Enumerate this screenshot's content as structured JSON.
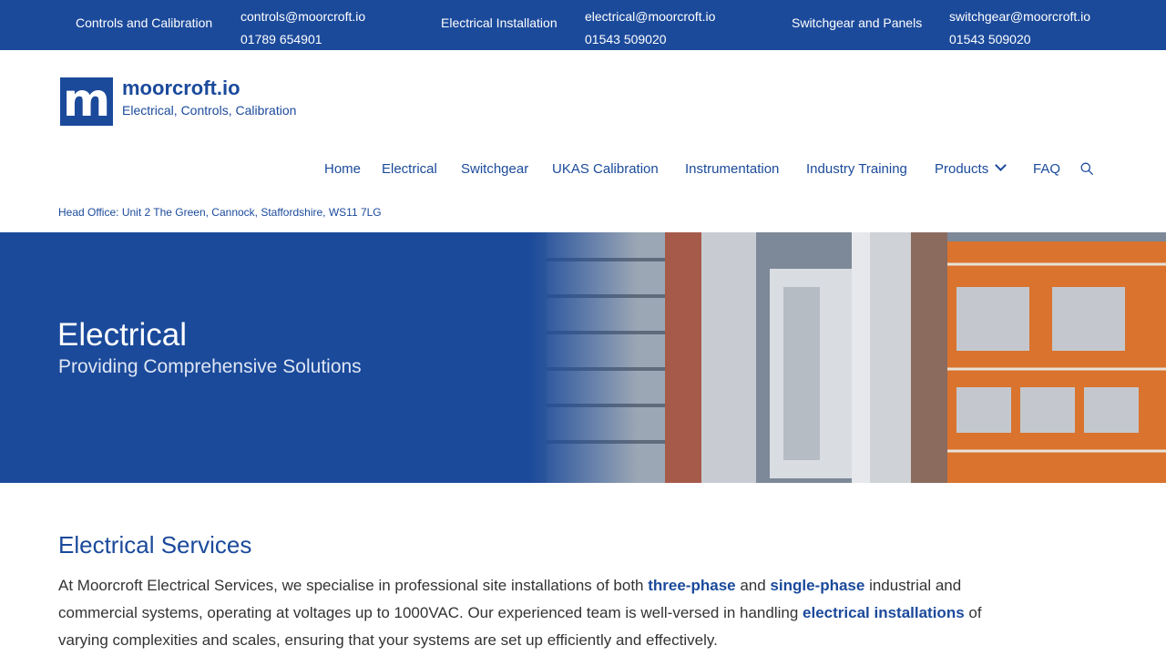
{
  "topbar": {
    "groups": [
      {
        "label": "Controls and Calibration",
        "email": "controls@moorcroft.io",
        "phone": "01789 654901"
      },
      {
        "label": "Electrical Installation",
        "email": "electrical@moorcroft.io",
        "phone": "01543 509020"
      },
      {
        "label": "Switchgear and Panels",
        "email": "switchgear@moorcroft.io",
        "phone": "01543 509020"
      }
    ]
  },
  "logo": {
    "mark": "m",
    "name": "moorcroft.io",
    "tagline": "Electrical, Controls, Calibration"
  },
  "nav": {
    "items": [
      "Home",
      "Electrical",
      "Switchgear",
      "UKAS Calibration",
      "Instrumentation",
      "Industry Training",
      "Products",
      "FAQ"
    ],
    "search_icon": "search-icon"
  },
  "head_office": "Head Office: Unit 2 The Green, Cannock, Staffordshire, WS11 7LG",
  "hero": {
    "title": "Electrical",
    "subtitle": "Providing Comprehensive Solutions"
  },
  "content": {
    "heading": "Electrical Services",
    "paragraph": {
      "t1": "At Moorcroft Electrical Services, we specialise in professional site installations of both ",
      "l1": "three-phase",
      "t2": " and ",
      "l2": "single-phase",
      "t3": " industrial and commercial systems, operating at voltages up to 1000VAC. Our experienced team is well-versed in handling ",
      "l3": "electrical installations",
      "t4": " of varying complexities and scales, ensuring that your systems are set up efficiently and effectively."
    }
  },
  "colors": {
    "brand": "#1b4a9b",
    "white": "#ffffff",
    "text": "#333333"
  }
}
